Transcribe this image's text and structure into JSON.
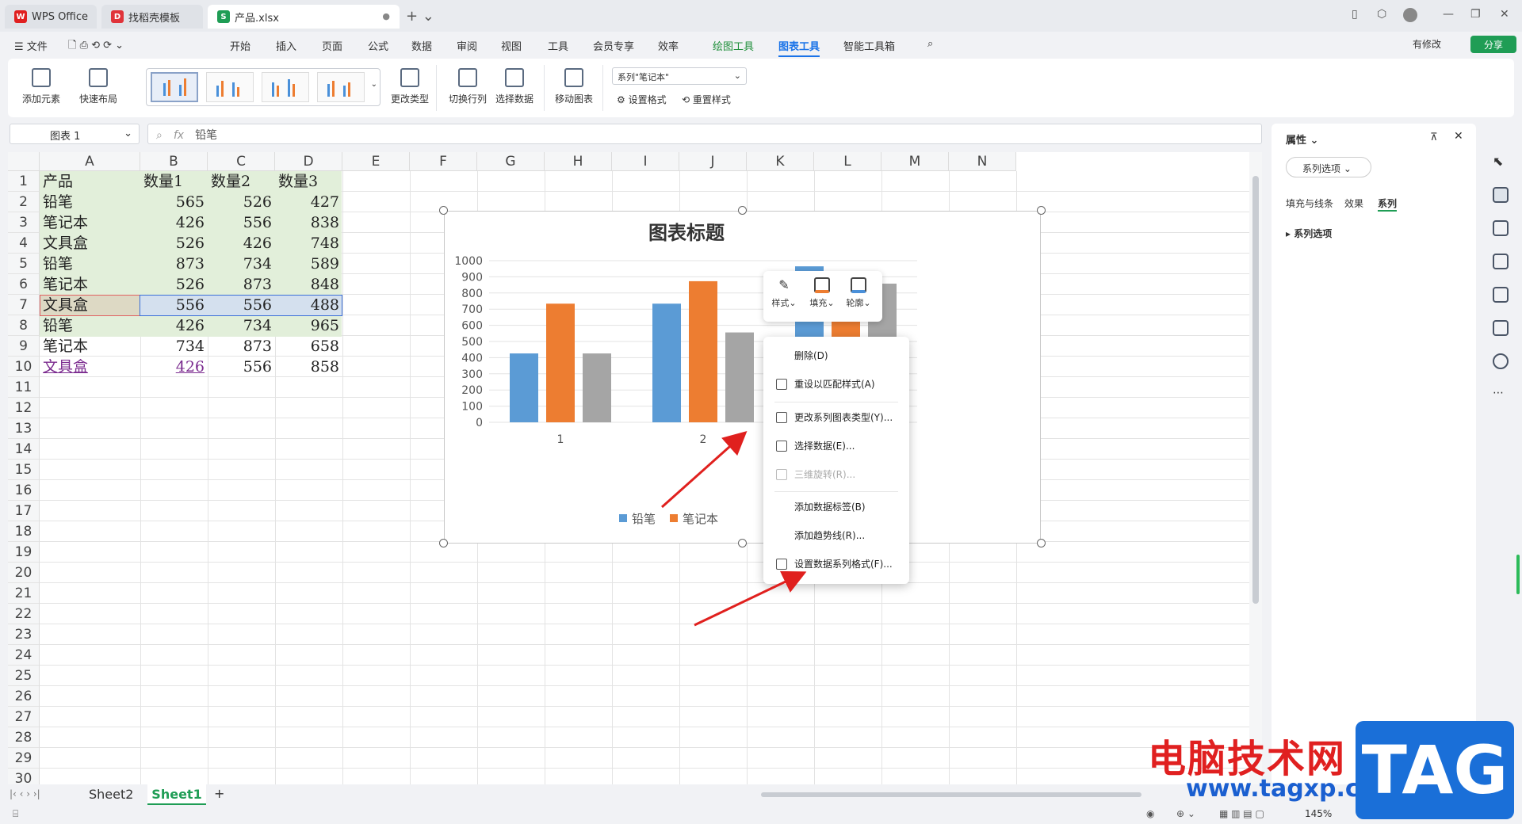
{
  "tabs": {
    "wps": "WPS Office",
    "daoke": "找稻壳模板",
    "file": "产品.xlsx"
  },
  "menu": [
    "文件",
    "开始",
    "插入",
    "页面",
    "公式",
    "数据",
    "审阅",
    "视图",
    "工具",
    "会员专享",
    "效率",
    "绘图工具",
    "图表工具",
    "智能工具箱"
  ],
  "right_header": {
    "modified": "有修改",
    "share": "分享"
  },
  "ribbon": {
    "add_element": "添加元素",
    "quick_layout": "快速布局",
    "change_type": "更改类型",
    "switch_rowcol": "切换行列",
    "select_data": "选择数据",
    "move_chart": "移动图表",
    "series_select": "系列\"笔记本\"",
    "set_format": "设置格式",
    "reset_style": "重置样式"
  },
  "formula": {
    "namebox": "图表 1",
    "fx": "fx",
    "value": "铅笔"
  },
  "columns": [
    "A",
    "B",
    "C",
    "D",
    "E",
    "F",
    "G",
    "H",
    "I",
    "J",
    "K",
    "L",
    "M",
    "N"
  ],
  "rows": [
    "1",
    "2",
    "3",
    "4",
    "5",
    "6",
    "7",
    "8",
    "9",
    "10",
    "11",
    "12",
    "13",
    "14",
    "15",
    "16",
    "17",
    "18",
    "19",
    "20",
    "21",
    "22",
    "23",
    "24",
    "25",
    "26",
    "27",
    "28",
    "29",
    "30"
  ],
  "table": {
    "headers": [
      "产品",
      "数量1",
      "数量2",
      "数量3"
    ],
    "rows": [
      [
        "铅笔",
        "565",
        "526",
        "427"
      ],
      [
        "笔记本",
        "426",
        "556",
        "838"
      ],
      [
        "文具盒",
        "526",
        "426",
        "748"
      ],
      [
        "铅笔",
        "873",
        "734",
        "589"
      ],
      [
        "笔记本",
        "526",
        "873",
        "848"
      ],
      [
        "文具盒",
        "556",
        "556",
        "488"
      ],
      [
        "铅笔",
        "426",
        "734",
        "965"
      ],
      [
        "笔记本",
        "734",
        "873",
        "658"
      ],
      [
        "文具盒",
        "426",
        "556",
        "858"
      ]
    ]
  },
  "chart_data": {
    "type": "bar",
    "title": "图表标题",
    "categories": [
      "1",
      "2",
      "3"
    ],
    "yticks": [
      "1000",
      "900",
      "800",
      "700",
      "600",
      "500",
      "400",
      "300",
      "200",
      "100",
      "0"
    ],
    "ylim": [
      0,
      1000
    ],
    "series": [
      {
        "name": "铅笔",
        "color": "#5b9bd5",
        "values": [
          426,
          734,
          965
        ]
      },
      {
        "name": "笔记本",
        "color": "#ed7d31",
        "values": [
          734,
          873,
          658
        ]
      },
      {
        "name": "文具盒",
        "color": "#a5a5a5",
        "values": [
          426,
          556,
          858
        ]
      }
    ],
    "legend_visible": [
      "铅笔",
      "笔记本"
    ],
    "legend": "bottom"
  },
  "minibar": {
    "style": "样式",
    "fill": "填充",
    "outline": "轮廓"
  },
  "context_menu": [
    "删除(D)",
    "重设以匹配样式(A)",
    "更改系列图表类型(Y)...",
    "选择数据(E)...",
    "三维旋转(R)...",
    "添加数据标签(B)",
    "添加趋势线(R)...",
    "设置数据系列格式(F)..."
  ],
  "panel": {
    "title": "属性",
    "option": "系列选项",
    "tab1": "填充与线条",
    "tab2": "效果",
    "tab3": "系列",
    "section": "系列选项"
  },
  "sheets": [
    "Sheet2",
    "Sheet1"
  ],
  "status": {
    "zoom": "145%"
  },
  "watermark": {
    "cn": "电脑技术网",
    "url": "www.tagxp.com",
    "logo": "TAG"
  }
}
